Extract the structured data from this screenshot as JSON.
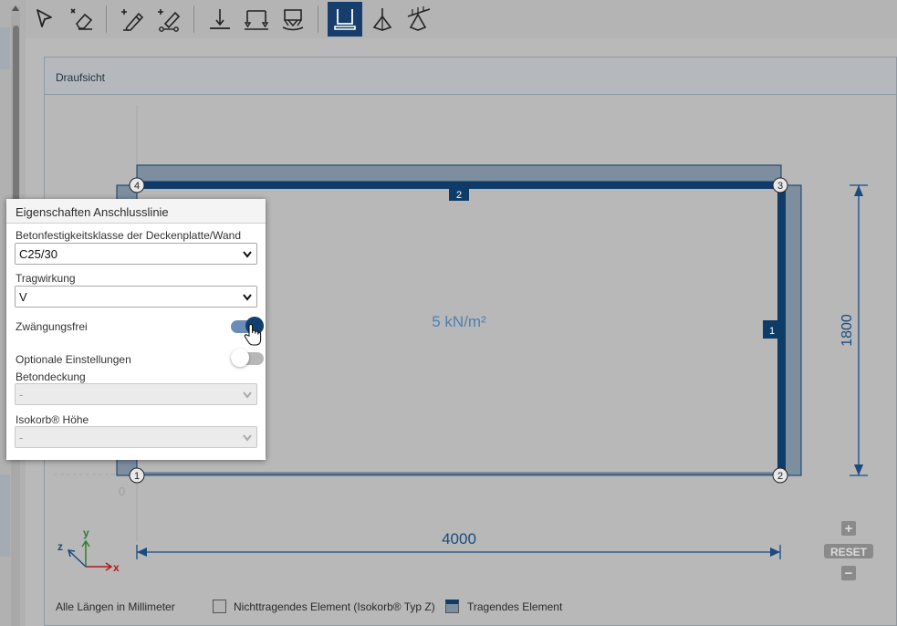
{
  "toolbar": {
    "tools": [
      {
        "name": "select-tool",
        "icon": "cursor-arrow-icon"
      },
      {
        "name": "erase-tool",
        "icon": "eraser-icon"
      },
      {
        "name": "draw-line-tool",
        "icon": "pencil-plus-icon"
      },
      {
        "name": "draw-node-tool",
        "icon": "pencil-node-icon"
      },
      {
        "name": "support-point-tool",
        "icon": "point-support-icon"
      },
      {
        "name": "support-line-tool",
        "icon": "line-support-icon"
      },
      {
        "name": "support-area-tool",
        "icon": "area-support-icon"
      },
      {
        "name": "connection-line-tool",
        "icon": "connection-line-icon",
        "active": true
      },
      {
        "name": "point-load-tool",
        "icon": "point-load-icon"
      },
      {
        "name": "line-load-tool",
        "icon": "line-load-icon"
      }
    ],
    "active_color": "#153e6d"
  },
  "panel": {
    "title": "Draufsicht"
  },
  "drawing": {
    "load_label": "5 kN/m²",
    "width_dim": "4000",
    "height_dim": "1800",
    "origin_label": "0",
    "nodes": [
      "1",
      "2",
      "3",
      "4"
    ],
    "edges": [
      "1",
      "2"
    ],
    "axes": {
      "x": "x",
      "y": "y",
      "z": "z"
    },
    "colors": {
      "beam": "#0f3b69",
      "shade": "#7d8e9f",
      "dimension": "#1a4b80",
      "load": "#4f7fb2",
      "axis_x": "#b01c1c",
      "axis_y": "#2e7d32",
      "axis_z": "#1a4b80"
    }
  },
  "zoom": {
    "plus": "+",
    "reset": "RESET",
    "minus": "−"
  },
  "footer": {
    "units": "Alle Längen in Millimeter",
    "legend": [
      {
        "label": "Nichttragendes Element (Isokorb® Typ Z)"
      },
      {
        "label": "Tragendes Element"
      }
    ]
  },
  "properties": {
    "title": "Eigenschaften Anschlusslinie",
    "concrete_label": "Betonfestigkeitsklasse der Deckenplatte/Wand",
    "concrete_value": "C25/30",
    "action_label": "Tragwirkung",
    "action_value": "V",
    "constraint_label": "Zwängungsfrei",
    "constraint_on": true,
    "optional_label": "Optionale Einstellungen",
    "optional_on": false,
    "cover_label": "Betondeckung",
    "cover_value": "-",
    "height_label": "Isokorb® Höhe",
    "height_value": "-"
  }
}
